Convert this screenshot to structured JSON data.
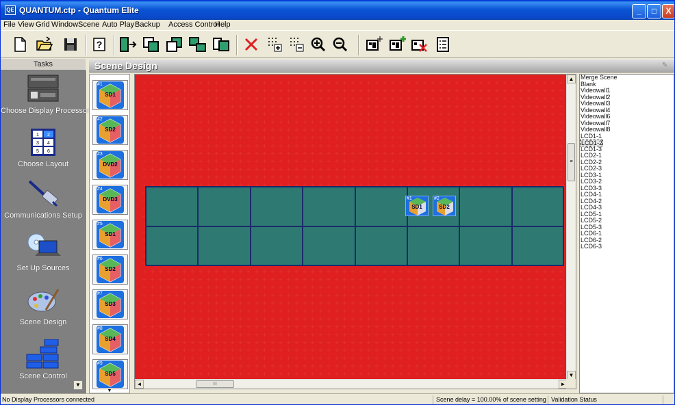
{
  "window": {
    "app_icon_text": "QE",
    "title": "QUANTUM.ctp - Quantum Elite",
    "minimize": "_",
    "maximize": "□",
    "close": "X"
  },
  "menu": [
    "File",
    "View",
    "Grid",
    "Window",
    "Scene",
    "Auto Play",
    "Backup",
    "Access Control",
    "Help"
  ],
  "toolbar": [
    {
      "name": "new-file-icon"
    },
    {
      "name": "open-folder-icon"
    },
    {
      "name": "save-disk-icon"
    },
    {
      "name": "help-icon"
    },
    {
      "name": "bring-forward-icon"
    },
    {
      "name": "window-front-icon"
    },
    {
      "name": "window-back-icon"
    },
    {
      "name": "window-cascade-icon"
    },
    {
      "name": "window-tile-icon"
    },
    {
      "name": "delete-x-icon"
    },
    {
      "name": "grid-add-icon"
    },
    {
      "name": "grid-remove-icon"
    },
    {
      "name": "zoom-in-icon"
    },
    {
      "name": "zoom-out-icon"
    },
    {
      "name": "scene-new-icon"
    },
    {
      "name": "scene-add-icon"
    },
    {
      "name": "scene-delete-icon"
    },
    {
      "name": "scene-list-icon"
    }
  ],
  "tasks": {
    "header": "Tasks",
    "items": [
      {
        "label": "Choose Display Processors",
        "icon": "display-processor-icon"
      },
      {
        "label": "Choose Layout",
        "icon": "layout-grid-icon"
      },
      {
        "label": "Communications Setup",
        "icon": "cable-plug-icon"
      },
      {
        "label": "Set Up Sources",
        "icon": "laptop-disc-icon"
      },
      {
        "label": "Scene Design",
        "icon": "paint-palette-icon"
      },
      {
        "label": "Scene Control",
        "icon": "blocks-icon"
      }
    ],
    "scroll_down": "▼"
  },
  "panel": {
    "title": "Scene Design",
    "pin": "✎"
  },
  "sources": [
    {
      "num": "#1",
      "label": "SD1"
    },
    {
      "num": "#2",
      "label": "SD2"
    },
    {
      "num": "#3",
      "label": "DVD2"
    },
    {
      "num": "#4",
      "label": "DVD3"
    },
    {
      "num": "#5",
      "label": "SD1"
    },
    {
      "num": "#6",
      "label": "SD2"
    },
    {
      "num": "#7",
      "label": "SD3"
    },
    {
      "num": "#8",
      "label": "SD4"
    },
    {
      "num": "#9",
      "label": "SD5"
    }
  ],
  "sources_scroll": "▼",
  "canvas": {
    "scroll_up": "▲",
    "scroll_down": "▼",
    "scroll_left": "◄",
    "scroll_right": "►",
    "hthumb_grip": "III",
    "vthumb_grip": "≡",
    "markers": [
      {
        "num": "#1",
        "label": "SD1"
      },
      {
        "num": "#2",
        "label": "SD2"
      }
    ]
  },
  "scenes": {
    "selected": "LCD1-2",
    "items": [
      "Merge Scene",
      "Blank",
      "Videowall1",
      "Videowall2",
      "Videowall3",
      "Videowall4",
      "Videowall6",
      "Videowall7",
      "Videowall8",
      "LCD1-1",
      "LCD1-2",
      "LCD1-3",
      "LCD2-1",
      "LCD2-2",
      "LCD2-3",
      "LCD3-1",
      "LCD3-2",
      "LCD3-3",
      "LCD4-1",
      "LCD4-2",
      "LCD4-3",
      "LCD5-1",
      "LCD5-2",
      "LCD5-3",
      "LCD6-1",
      "LCD6-2",
      "LCD6-3"
    ]
  },
  "status": {
    "left": "No Display Processors connected",
    "delay": "Scene delay = 100.00% of scene setting",
    "validation": "Validation Status"
  }
}
